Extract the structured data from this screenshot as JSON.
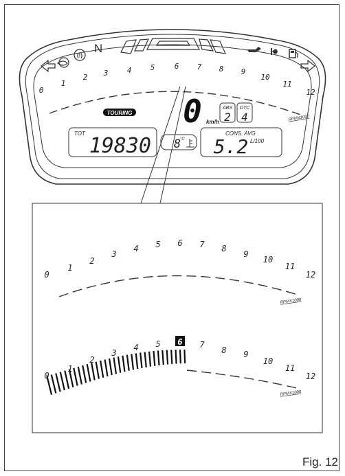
{
  "figure": {
    "caption": "Fig. 12"
  },
  "dashboard": {
    "rpm_scale": [
      "0",
      "1",
      "2",
      "3",
      "4",
      "5",
      "6",
      "7",
      "8",
      "9",
      "10",
      "11",
      "12"
    ],
    "rpm_unit": "RPMX1000",
    "neutral": "N",
    "riding_mode": "TOURING",
    "speed": "0",
    "speed_unit": "km/h",
    "abs_label": "ABS",
    "abs_level": "2",
    "dtc_label": "DTC",
    "dtc_level": "4",
    "odometer_label": "TOT",
    "odometer_value": "19830",
    "coolant_temp": "8",
    "temp_unit": "°C",
    "consumption_label": "CONS. AVG",
    "consumption_value": "5.2",
    "consumption_unit": "L/100"
  },
  "detail_top": {
    "rpm_scale": [
      "0",
      "1",
      "2",
      "3",
      "4",
      "5",
      "6",
      "7",
      "8",
      "9",
      "10",
      "11",
      "12"
    ],
    "rpm_unit": "RPMX1000"
  },
  "detail_bottom": {
    "rpm_scale": [
      "0",
      "1",
      "2",
      "3",
      "4",
      "5",
      "6",
      "7",
      "8",
      "9",
      "10",
      "11",
      "12"
    ],
    "rpm_unit": "RPMX1000",
    "highlighted_rpm": "6"
  }
}
